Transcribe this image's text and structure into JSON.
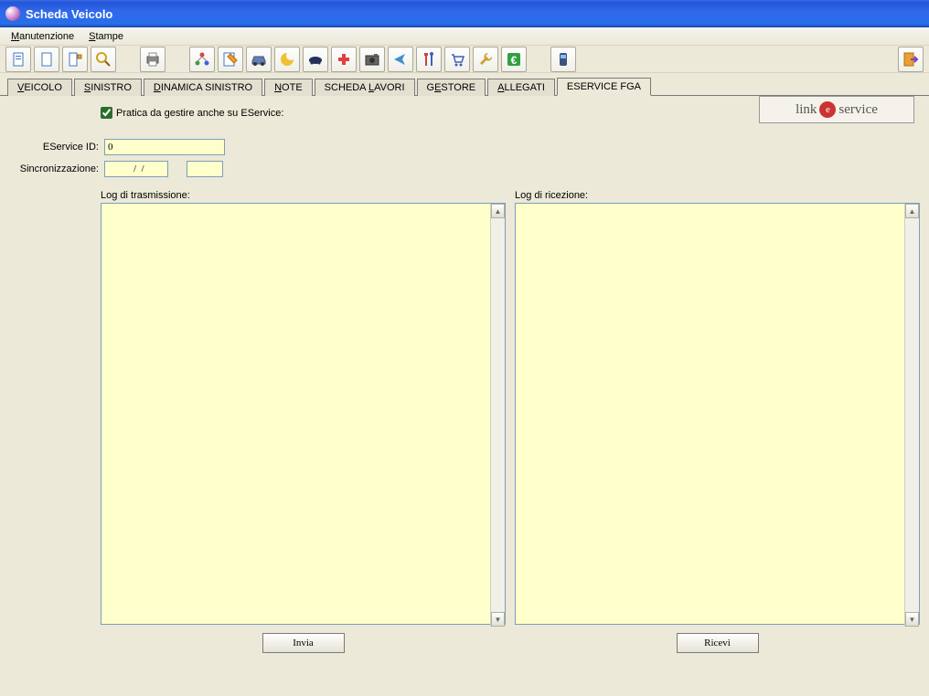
{
  "window": {
    "title": "Scheda Veicolo"
  },
  "menu": {
    "manutenzione": "Manutenzione",
    "stampe": "Stampe"
  },
  "tabs": {
    "veicolo": "VEICOLO",
    "sinistro": "SINISTRO",
    "dinamica": "DINAMICA SINISTRO",
    "note": "NOTE",
    "scheda_lavori": "SCHEDA LAVORI",
    "gestore": "GESTORE",
    "allegati": "ALLEGATI",
    "eservice": "ESERVICE FGA"
  },
  "form": {
    "pratica_label": "Pratica da gestire anche su EService:",
    "pratica_checked": true,
    "eservice_id_label": "EService ID:",
    "eservice_id_value": "0",
    "sincro_label": "Sincronizzazione:",
    "sincro_date": "  /  /",
    "sincro_time": ""
  },
  "logs": {
    "trasmissione_label": "Log di trasmissione:",
    "trasmissione_value": "",
    "ricezione_label": "Log di ricezione:",
    "ricezione_value": ""
  },
  "buttons": {
    "invia": "Invia",
    "ricevi": "Ricevi"
  },
  "logo": {
    "text1": "link",
    "text2": "service",
    "e": "e"
  }
}
